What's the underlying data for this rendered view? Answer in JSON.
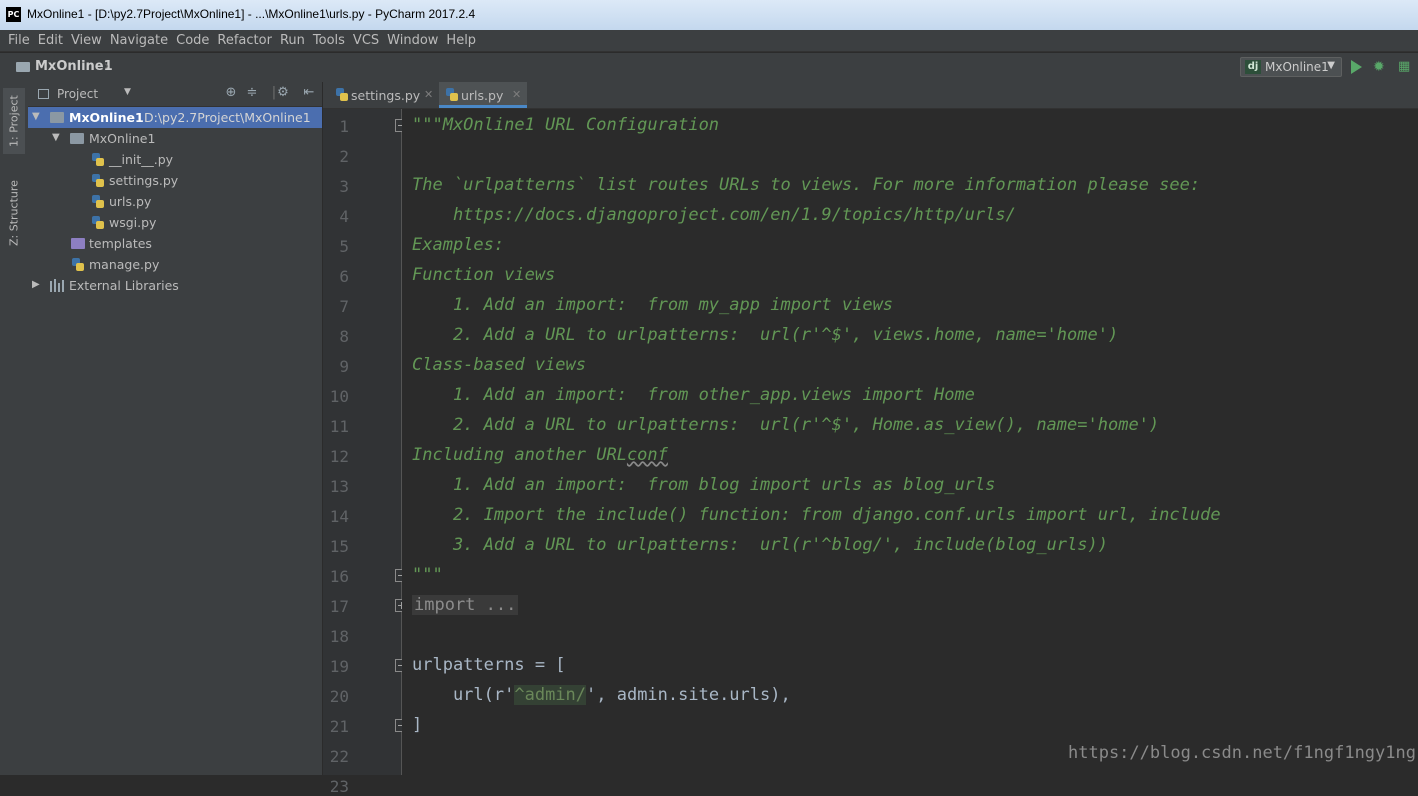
{
  "window": {
    "app_icon": "PC",
    "title": "MxOnline1 - [D:\\py2.7Project\\MxOnline1] - ...\\MxOnline1\\urls.py - PyCharm 2017.2.4"
  },
  "menu": [
    "File",
    "Edit",
    "View",
    "Navigate",
    "Code",
    "Refactor",
    "Run",
    "Tools",
    "VCS",
    "Window",
    "Help"
  ],
  "navbar": {
    "breadcrumb": "MxOnline1",
    "run_config": "MxOnline1",
    "run_config_icon": "dj"
  },
  "tool_strip": {
    "project_tab": "1: Project",
    "structure_tab": "Z: Structure"
  },
  "project_panel": {
    "view_label": "Project",
    "tree": [
      {
        "label": "MxOnline1",
        "path": "D:\\py2.7Project\\MxOnline1",
        "kind": "root-folder",
        "expanded": true,
        "selected": true
      },
      {
        "label": "MxOnline1",
        "kind": "package-folder",
        "expanded": true
      },
      {
        "label": "__init__.py",
        "kind": "python-file"
      },
      {
        "label": "settings.py",
        "kind": "python-file"
      },
      {
        "label": "urls.py",
        "kind": "python-file"
      },
      {
        "label": "wsgi.py",
        "kind": "python-file"
      },
      {
        "label": "templates",
        "kind": "templates-folder"
      },
      {
        "label": "manage.py",
        "kind": "python-file"
      },
      {
        "label": "External Libraries",
        "kind": "library",
        "expanded": false
      }
    ]
  },
  "editor": {
    "tabs": [
      {
        "label": "settings.py",
        "active": false
      },
      {
        "label": "urls.py",
        "active": true
      }
    ],
    "line_numbers": [
      "1",
      "2",
      "3",
      "4",
      "5",
      "6",
      "7",
      "8",
      "9",
      "10",
      "11",
      "12",
      "13",
      "14",
      "15",
      "16",
      "17",
      "18",
      "19",
      "20",
      "21",
      "22",
      "23"
    ],
    "code_lines": [
      "\"\"\"MxOnline1 URL Configuration",
      "",
      "The `urlpatterns` list routes URLs to views. For more information please see:",
      "    https://docs.djangoproject.com/en/1.9/topics/http/urls/",
      "Examples:",
      "Function views",
      "    1. Add an import:  from my_app import views",
      "    2. Add a URL to urlpatterns:  url(r'^$', views.home, name='home')",
      "Class-based views",
      "    1. Add an import:  from other_app.views import Home",
      "    2. Add a URL to urlpatterns:  url(r'^$', Home.as_view(), name='home')",
      "Including another URLconf",
      "    1. Add an import:  from blog import urls as blog_urls",
      "    2. Import the include() function: from django.conf.urls import url, include",
      "    3. Add a URL to urlpatterns:  url(r'^blog/', include(blog_urls))",
      "\"\"\"",
      "import ...",
      "",
      "urlpatterns = [",
      "    url(r'^admin/', admin.site.urls),",
      "]",
      ""
    ],
    "line_12_prefix": "Including another URL",
    "line_12_squiggle": "conf",
    "line_20": {
      "indent": "    url(r'",
      "string": "^admin/",
      "rest": "', admin.site.urls),"
    }
  },
  "watermark": "https://blog.csdn.net/f1ngf1ngy1ng",
  "colors": {
    "editor_bg": "#2b2b2b",
    "panel_bg": "#3c3f41",
    "selection": "#4b6eaf",
    "docstring": "#629755",
    "code": "#a9b7c6",
    "string": "#6a8759",
    "run_green": "#59a869"
  }
}
